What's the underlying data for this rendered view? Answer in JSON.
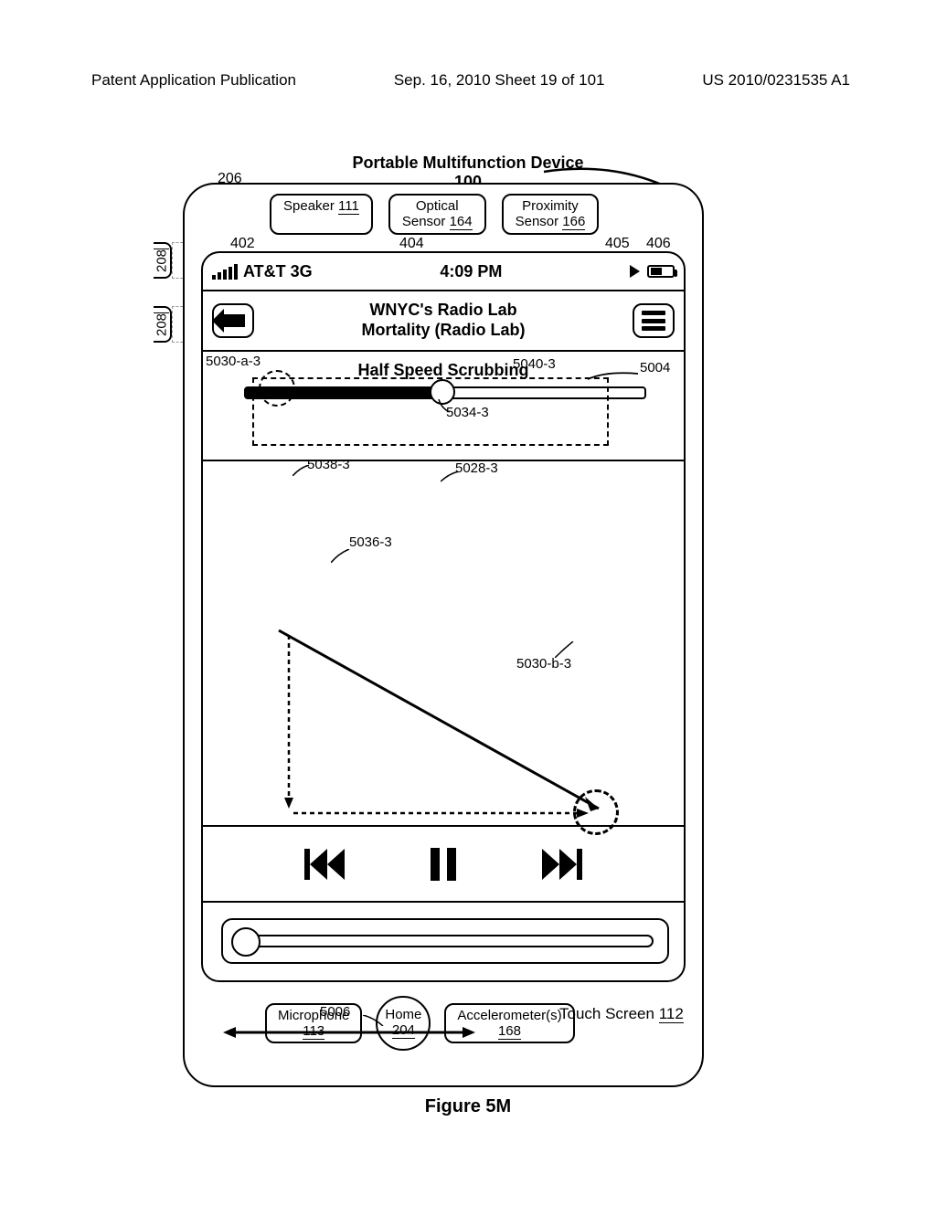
{
  "header": {
    "left": "Patent Application Publication",
    "center": "Sep. 16, 2010 Sheet 19 of 101",
    "right": "US 2010/0231535 A1"
  },
  "device": {
    "title_line": "Portable Multifunction Device",
    "num": "100"
  },
  "refs": {
    "r206": "206",
    "r208": "208",
    "r402": "402",
    "r404": "404",
    "r405": "405",
    "r406": "406",
    "r5030a3": "5030-a-3",
    "r5040_3": "5040-3",
    "r5004": "5004",
    "r5034_3": "5034-3",
    "r5038_3": "5038-3",
    "r5028_3": "5028-3",
    "r5036_3": "5036-3",
    "r5030b3": "5030-b-3",
    "r5006": "5006"
  },
  "sensors": {
    "speaker": {
      "label": "Speaker",
      "num": "111"
    },
    "optical": {
      "label": "Optical",
      "label2": "Sensor",
      "num": "164"
    },
    "proximity": {
      "label": "Proximity",
      "label2": "Sensor",
      "num": "166"
    }
  },
  "status": {
    "carrier": "AT&T 3G",
    "time": "4:09 PM"
  },
  "title": {
    "line1": "WNYC's Radio Lab",
    "line2": "Mortality (Radio Lab)"
  },
  "scrub": {
    "mode": "Half Speed Scrubbing"
  },
  "touchscreen": {
    "label": "Touch Screen",
    "num": "112"
  },
  "bottom": {
    "microphone": {
      "label": "Microphone",
      "num": "113"
    },
    "home": {
      "label": "Home",
      "num": "204"
    },
    "accel": {
      "label": "Accelerometer(s)",
      "num": "168"
    }
  },
  "figure": "Figure 5M"
}
